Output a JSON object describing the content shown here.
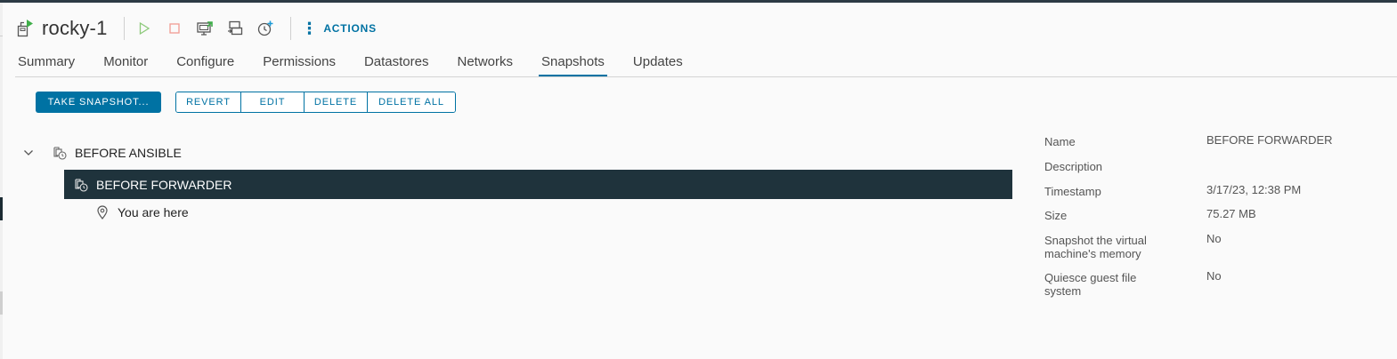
{
  "vm": {
    "name": "rocky-1"
  },
  "toolbar": {
    "icons": [
      "vm-icon",
      "power-on-icon",
      "power-off-icon",
      "launch-console-icon",
      "migrate-icon",
      "take-snapshot-icon"
    ],
    "actions_label": "ACTIONS"
  },
  "tabs": [
    {
      "label": "Summary"
    },
    {
      "label": "Monitor"
    },
    {
      "label": "Configure"
    },
    {
      "label": "Permissions"
    },
    {
      "label": "Datastores"
    },
    {
      "label": "Networks"
    },
    {
      "label": "Snapshots",
      "active": true
    },
    {
      "label": "Updates"
    }
  ],
  "snapshot_toolbar": {
    "take_snapshot": "TAKE SNAPSHOT...",
    "revert": "REVERT",
    "edit": "EDIT",
    "delete": "DELETE",
    "delete_all": "DELETE ALL"
  },
  "tree": {
    "root": {
      "label": "BEFORE ANSIBLE",
      "expanded": true
    },
    "child": {
      "label": "BEFORE FORWARDER",
      "selected": true
    },
    "current": {
      "label": "You are here"
    }
  },
  "details": {
    "name_label": "Name",
    "name_value": "BEFORE FORWARDER",
    "description_label": "Description",
    "description_value": "",
    "timestamp_label": "Timestamp",
    "timestamp_value": "3/17/23, 12:38 PM",
    "size_label": "Size",
    "size_value": "75.27 MB",
    "memory_label_1": "Snapshot the virtual",
    "memory_label_2": "machine's memory",
    "memory_value": "No",
    "quiesce_label_1": "Quiesce guest file",
    "quiesce_label_2": "system",
    "quiesce_value": "No"
  },
  "colors": {
    "accent": "#0072a3",
    "selected_row": "#1f333c",
    "power_on": "#7ec26b",
    "power_off": "#f2a7a0",
    "top_bar": "#2c3a44"
  }
}
